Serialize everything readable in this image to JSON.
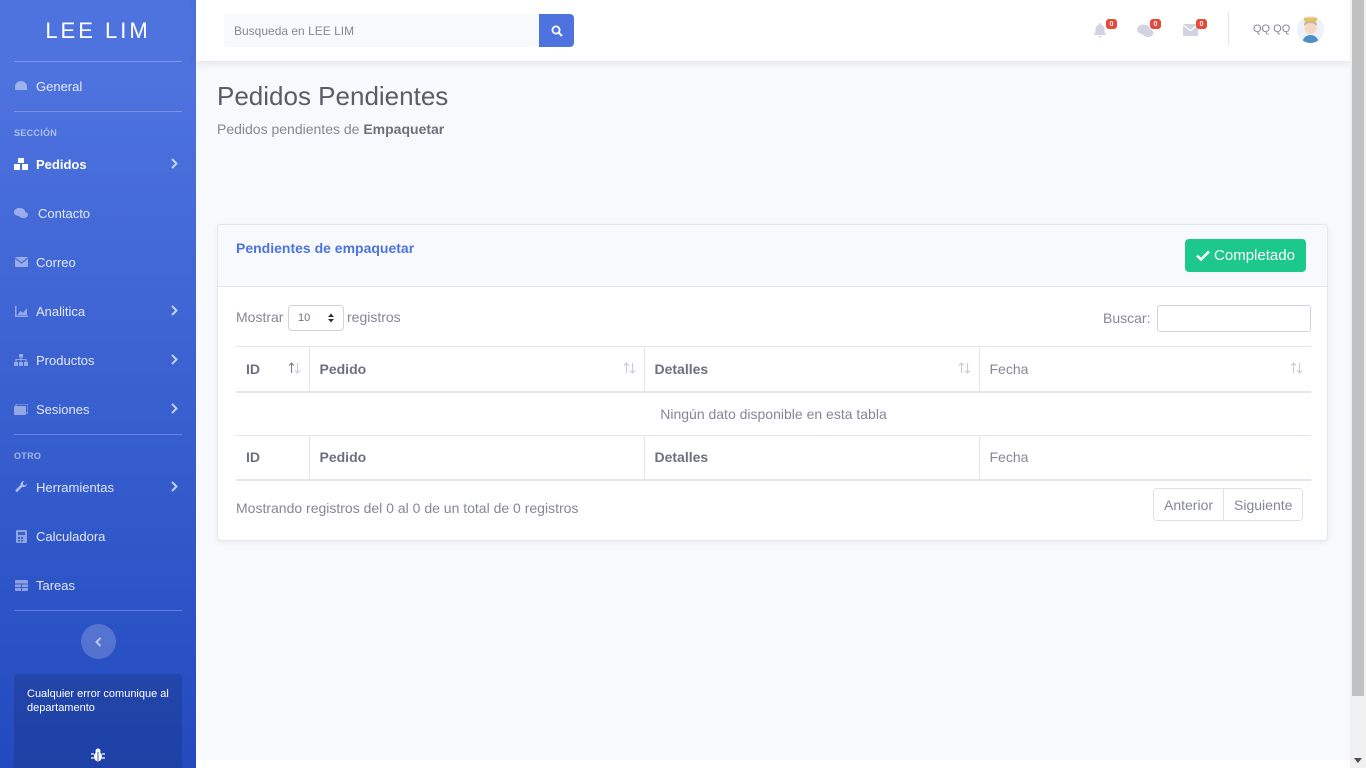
{
  "sidebar": {
    "brand": "LEE LIM",
    "items": [
      {
        "label": "General",
        "icon": "dashboard-icon"
      },
      {
        "label": "Pedidos",
        "icon": "boxes-icon"
      },
      {
        "label": "Contacto",
        "icon": "comments-icon"
      },
      {
        "label": "Correo",
        "icon": "envelope-icon"
      },
      {
        "label": "Analitica",
        "icon": "area-chart-icon"
      },
      {
        "label": "Productos",
        "icon": "sitemap-icon"
      },
      {
        "label": "Sesiones",
        "icon": "photo-icon"
      },
      {
        "label": "Herramientas",
        "icon": "wrench-icon"
      },
      {
        "label": "Calculadora",
        "icon": "calculator-icon"
      },
      {
        "label": "Tareas",
        "icon": "table-icon"
      }
    ],
    "heading_section": "SECCIÓN",
    "heading_other": "OTRO",
    "card_text": "Cualquier error comunique al departamento"
  },
  "topbar": {
    "search_placeholder": "Busqueda en LEE LIM",
    "alerts_count": "0",
    "messages_count": "0",
    "mail_count": "0",
    "user_name": "QQ QQ"
  },
  "page": {
    "title": "Pedidos Pendientes",
    "subtitle_prefix": "Pedidos pendientes de ",
    "subtitle_bold": "Empaquetar"
  },
  "card": {
    "title": "Pendientes de empaquetar",
    "complete_button": "Completado",
    "length_label": "Mostrar",
    "length_value": "10",
    "length_suffix": "registros",
    "search_label": "Buscar:",
    "columns": [
      "ID",
      "Pedido",
      "Detalles",
      "Fecha"
    ],
    "empty_message": "Ningún dato disponible en esta tabla",
    "info": "Mostrando registros del 0 al 0 de un total de 0 registros",
    "prev": "Anterior",
    "next": "Siguiente"
  },
  "colors": {
    "primary": "#4e73df",
    "success": "#1cc88a",
    "danger": "#e74a3b"
  }
}
